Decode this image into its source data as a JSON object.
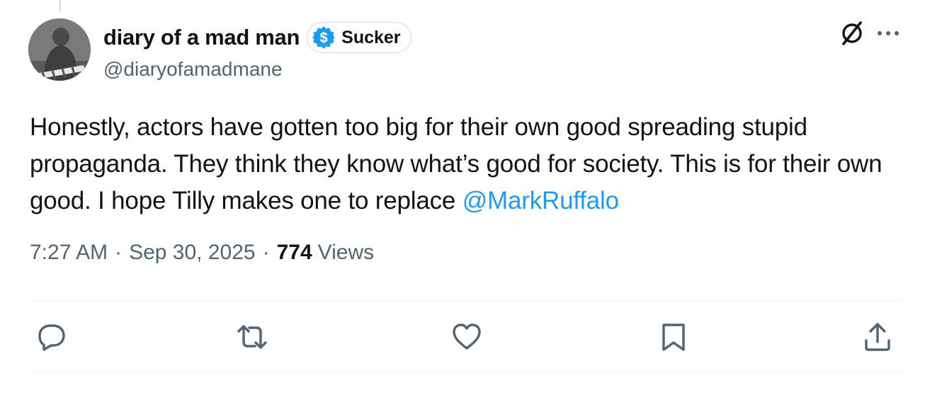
{
  "author": {
    "display_name": "diary of a mad man",
    "handle": "@diaryofamadmane",
    "badge_label": "Sucker",
    "badge_icon": "dollar-sign-badge-icon",
    "avatar": "profile-avatar"
  },
  "tweet": {
    "text_main": "Honestly, actors have gotten too big for their own good spreading stupid propaganda. They think they know what’s good for society. This is for their own good. I hope Tilly makes one to replace ",
    "mention": "@MarkRuffalo"
  },
  "meta": {
    "time": "7:27 AM",
    "separator": "·",
    "date": "Sep 30, 2025",
    "views_count": "774",
    "views_label": "Views"
  },
  "icons": {
    "grok": "grok-icon",
    "more": "more-icon",
    "reply": "reply-icon",
    "repost": "repost-icon",
    "like": "heart-icon",
    "bookmark": "bookmark-icon",
    "share": "share-icon"
  },
  "colors": {
    "text": "#0f1419",
    "secondary": "#536471",
    "link": "#1d9bf0",
    "border": "#cfd9de",
    "divider": "#eff3f4"
  }
}
